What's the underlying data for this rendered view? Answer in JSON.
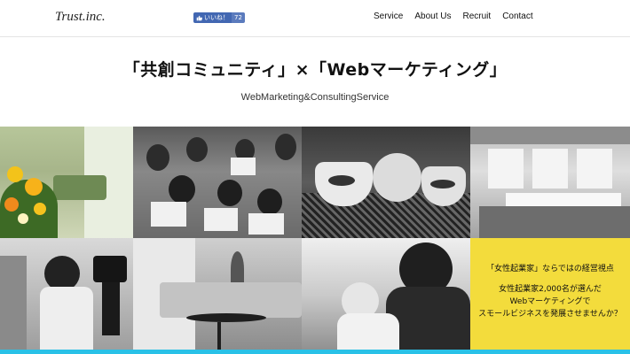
{
  "header": {
    "logo": "Trust.inc.",
    "fb_like": {
      "label": "いいね！",
      "count": "72"
    },
    "nav": [
      "Service",
      "About Us",
      "Recruit",
      "Contact"
    ]
  },
  "hero": {
    "headline": "「共創コミュニティ」×「Webマーケティング」",
    "subline": "WebMarketing&ConsultingService"
  },
  "promo": {
    "title": "「女性起業家」ならではの経営視点",
    "lines": [
      "女性起業家2,000名が選んだ",
      "Webマーケティングで",
      "スモールビジネスを発展させませんか？"
    ]
  },
  "colors": {
    "accent_bar": "#29c1e7",
    "promo_bg": "#f3dc3c",
    "fb_blue": "#4267b2"
  }
}
